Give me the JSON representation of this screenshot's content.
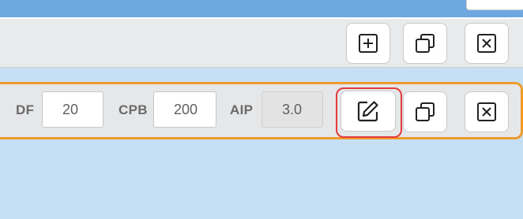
{
  "top_toolbar": {
    "add_icon": "plus-square-icon",
    "copy_icon": "copy-icon",
    "close_icon": "close-square-icon"
  },
  "item_row": {
    "fields": [
      {
        "label": "DF",
        "value": "20",
        "readonly": false
      },
      {
        "label": "CPB",
        "value": "200",
        "readonly": false
      },
      {
        "label": "AIP",
        "value": "3.0",
        "readonly": true
      }
    ],
    "edit_icon": "edit-icon",
    "copy_icon": "copy-icon",
    "close_icon": "close-square-icon",
    "row_border_color": "#ef9a2b",
    "edit_highlight_color": "#e23b3b"
  }
}
